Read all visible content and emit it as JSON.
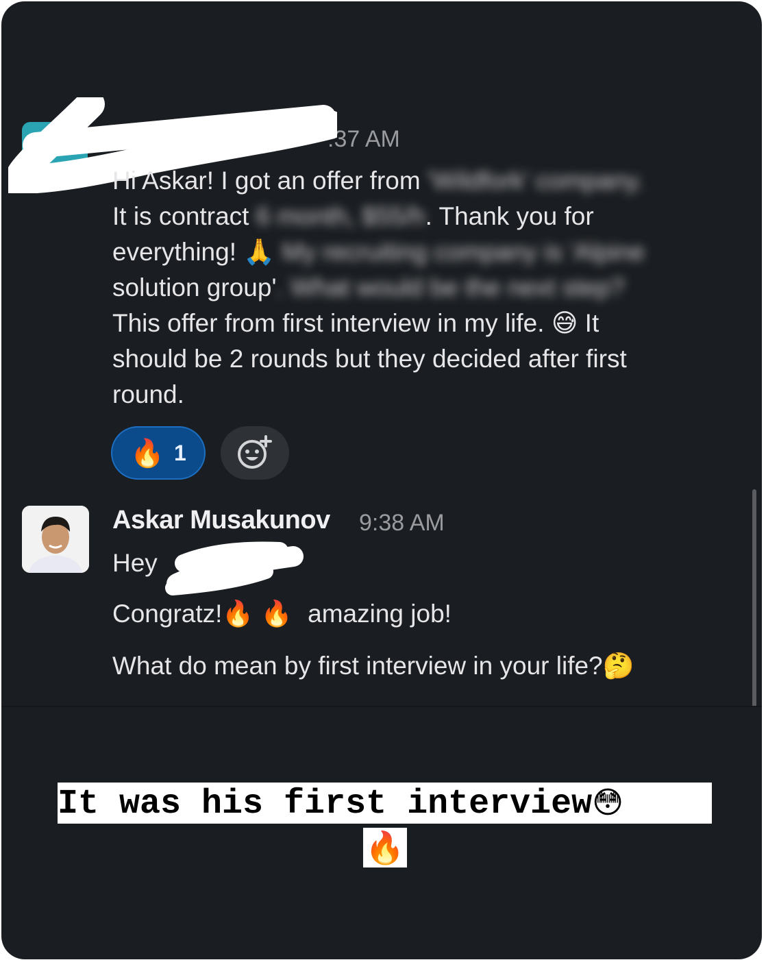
{
  "message1": {
    "time": ":37 AM",
    "line1_visible": "Hi Askar! I got an offer from",
    "line1_blurred": "'Wildfork' company.",
    "line2_visible": "It is contract",
    "line2_blurred": "6 month, $55/h",
    "line2_end": ". Thank you for",
    "line3_visible": "everything!",
    "line3_blurred": "My recruiting company is 'Alpine",
    "line4_visible": "solution group'",
    "line4_blurred": ". What would be the next step?",
    "line5": "This offer from first interview in my life.",
    "line5_end": "It",
    "line6": "should be 2 rounds but they decided after first",
    "line7": "round.",
    "reaction_count": "1"
  },
  "message2": {
    "author": "Askar Musakunov",
    "time": "9:38 AM",
    "greeting": "Hey",
    "line_congrats": "Congratz!",
    "line_congrats_end": "amazing job!",
    "line_question": "What do mean by first interview in your life?"
  },
  "caption": {
    "line1": "It was his first interview"
  },
  "icons": {
    "pray": "🙏",
    "sweat_smile": "😅",
    "fire": "🔥",
    "thinking": "🤔",
    "flushed": "😳",
    "add_reaction": "add-reaction-icon"
  },
  "colors": {
    "background": "#1a1d21",
    "reaction_active": "#0b4a8b",
    "reaction_inactive": "#2e3136",
    "avatar_teal": "#2aa3b3"
  }
}
